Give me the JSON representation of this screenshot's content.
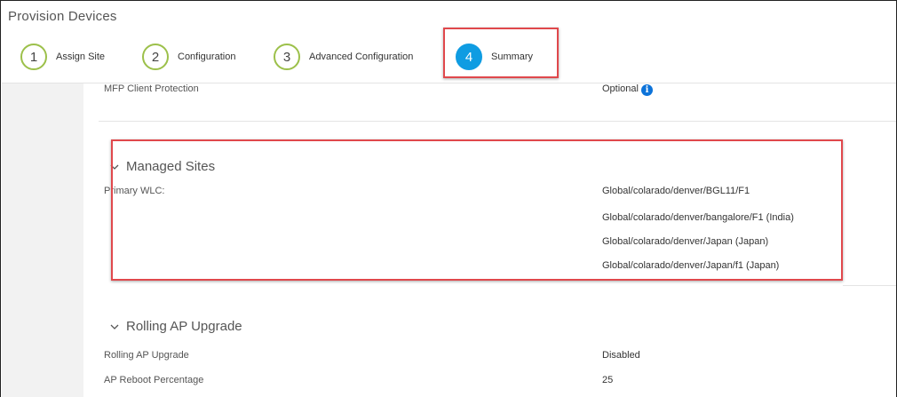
{
  "page": {
    "title": "Provision Devices"
  },
  "steps": [
    {
      "number": "1",
      "label": "Assign Site"
    },
    {
      "number": "2",
      "label": "Configuration"
    },
    {
      "number": "3",
      "label": "Advanced Configuration"
    },
    {
      "number": "4",
      "label": "Summary"
    }
  ],
  "mfp": {
    "label": "MFP Client Protection",
    "value": "Optional",
    "info_icon": "i"
  },
  "managed_sites": {
    "heading": "Managed Sites",
    "primary_label": "Primary WLC:",
    "sites": [
      "Global/colarado/denver/BGL11/F1",
      "Global/colarado/denver/bangalore/F1 (India)",
      "Global/colarado/denver/Japan (Japan)",
      "Global/colarado/denver/Japan/f1 (Japan)"
    ]
  },
  "rolling": {
    "heading": "Rolling AP Upgrade",
    "rows": [
      {
        "label": "Rolling AP Upgrade",
        "value": "Disabled"
      },
      {
        "label": "AP Reboot Percentage",
        "value": "25"
      }
    ]
  },
  "colors": {
    "accent": "#0f9ce2",
    "step_ring": "#9cc04a",
    "highlight": "#e0484c",
    "info": "#0d73d9"
  }
}
